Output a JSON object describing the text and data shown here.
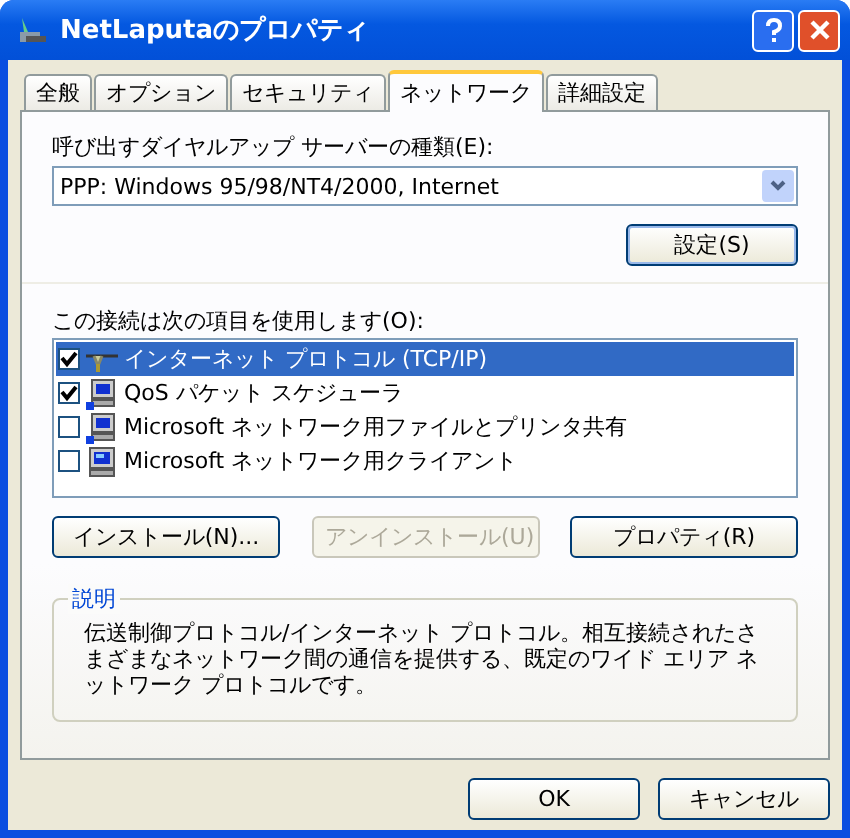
{
  "window": {
    "title": "NetLaputaのプロパティ"
  },
  "tabs": [
    {
      "label": "全般",
      "selected": false
    },
    {
      "label": "オプション",
      "selected": false
    },
    {
      "label": "セキュリティ",
      "selected": false
    },
    {
      "label": "ネットワーク",
      "selected": true
    },
    {
      "label": "詳細設定",
      "selected": false
    }
  ],
  "server_type": {
    "label": "呼び出すダイヤルアップ サーバーの種類(E):",
    "value": "PPP: Windows 95/98/NT4/2000, Internet"
  },
  "settings_button": {
    "label": "設定(S)"
  },
  "components": {
    "label": "この接続は次の項目を使用します(O):",
    "items": [
      {
        "kind": "protocol",
        "label": "インターネット プロトコル (TCP/IP)",
        "checked": true,
        "selected": true
      },
      {
        "kind": "service",
        "label": "QoS パケット スケジューラ",
        "checked": true,
        "selected": false
      },
      {
        "kind": "service",
        "label": "Microsoft ネットワーク用ファイルとプリンタ共有",
        "checked": false,
        "selected": false
      },
      {
        "kind": "client",
        "label": "Microsoft ネットワーク用クライアント",
        "checked": false,
        "selected": false
      }
    ]
  },
  "component_buttons": [
    {
      "label": "インストール(N)...",
      "disabled": false
    },
    {
      "label": "アンインストール(U)",
      "disabled": true
    },
    {
      "label": "プロパティ(R)",
      "disabled": false
    }
  ],
  "description": {
    "title": "説明",
    "text": "伝送制御プロトコル/インターネット プロトコル。相互接続されたさまざまなネットワーク間の通信を提供する、既定のワイド エリア ネットワーク プロトコルです。"
  },
  "buttons": [
    "OK",
    "キャンセル"
  ]
}
